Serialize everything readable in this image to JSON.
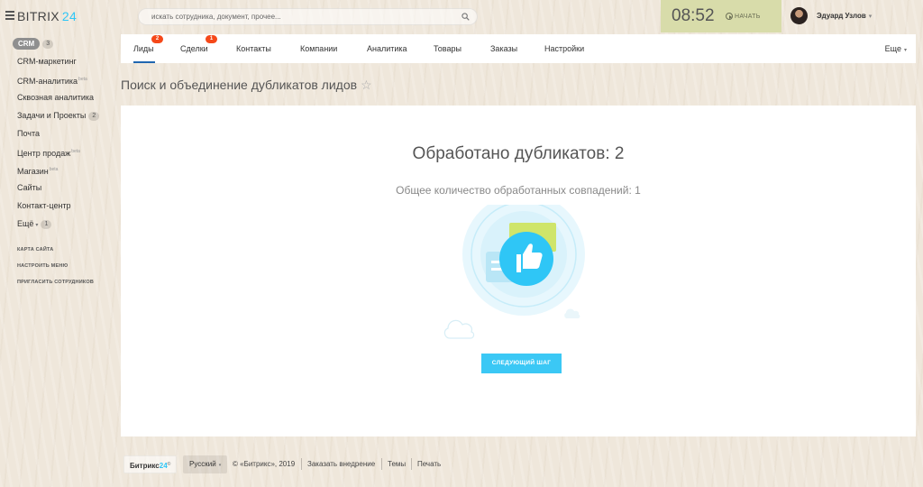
{
  "header": {
    "logo_name": "BITRIX",
    "logo_num": "24",
    "search_placeholder": "искать сотрудника, документ, прочее...",
    "clock": "08:52",
    "start_label": "НАЧАТЬ",
    "user_name": "Эдуард Узлов",
    "user_caret": "▾"
  },
  "sidebar": {
    "items": [
      {
        "label": "CRM",
        "counter": "3"
      },
      {
        "label": "CRM-маркетинг"
      },
      {
        "label": "CRM-аналитика",
        "beta": "beta"
      },
      {
        "label": "Сквозная аналитика"
      },
      {
        "label": "Задачи и Проекты",
        "counter": "2"
      },
      {
        "label": "Почта"
      },
      {
        "label": "Центр продаж",
        "beta": "beta"
      },
      {
        "label": "Магазин",
        "beta": "beta"
      },
      {
        "label": "Сайты"
      },
      {
        "label": "Контакт-центр"
      },
      {
        "label": "Ещё",
        "caret": "▾",
        "counter": "1"
      }
    ],
    "links": [
      "КАРТА САЙТА",
      "НАСТРОИТЬ МЕНЮ",
      "ПРИГЛАСИТЬ СОТРУДНИКОВ"
    ]
  },
  "tabs": [
    {
      "label": "Лиды",
      "badge": "2"
    },
    {
      "label": "Сделки",
      "badge": "1"
    },
    {
      "label": "Контакты"
    },
    {
      "label": "Компании"
    },
    {
      "label": "Аналитика"
    },
    {
      "label": "Товары"
    },
    {
      "label": "Заказы"
    },
    {
      "label": "Настройки"
    }
  ],
  "tabs_more": "Еще",
  "page_title": "Поиск и объединение дубликатов лидов",
  "main": {
    "processed": "Обработано дубликатов: 2",
    "total": "Общее количество обработанных совпадений: 1",
    "next_button": "СЛЕДУЮЩИЙ ШАГ"
  },
  "footer": {
    "brand_a": "Битрикс",
    "brand_b": "24",
    "brand_sup": "©",
    "language": "Русский",
    "copyright": "© «Битрикс», 2019",
    "order": "Заказать внедрение",
    "themes": "Темы",
    "print": "Печать"
  },
  "colors": {
    "accent": "#2fc6f6",
    "button": "#3bc8f5",
    "badge": "#f54819",
    "tab_underline": "#2067b0",
    "clock_bg": "#d8dcaa"
  }
}
